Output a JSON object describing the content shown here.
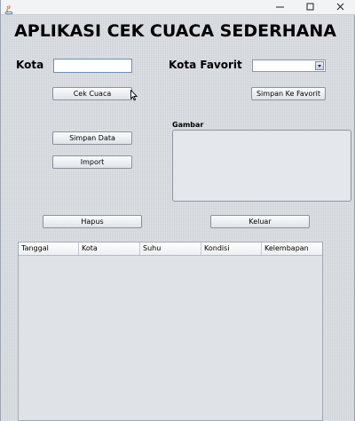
{
  "window": {
    "controls": {
      "minimize_icon": "minimize-icon",
      "maximize_icon": "maximize-icon",
      "close_icon": "close-icon"
    }
  },
  "header": {
    "title": "APLIKASI CEK CUACA SEDERHANA"
  },
  "form": {
    "kota_label": "Kota",
    "kota_value": "",
    "kota_favorit_label": "Kota Favorit",
    "kota_favorit_selected": ""
  },
  "buttons": {
    "cek_cuaca": "Cek Cuaca",
    "simpan_ke_favorit": "Simpan Ke Favorit",
    "simpan_data": "Simpan Data",
    "import": "Import",
    "hapus": "Hapus",
    "keluar": "Keluar"
  },
  "gambar": {
    "label": "Gambar"
  },
  "table": {
    "columns": [
      "Tanggal",
      "Kota",
      "Suhu",
      "Kondisi",
      "Kelembapan"
    ],
    "rows": []
  },
  "colors": {
    "background": "#d9dde2",
    "text_field_border": "#6b8fb8"
  }
}
